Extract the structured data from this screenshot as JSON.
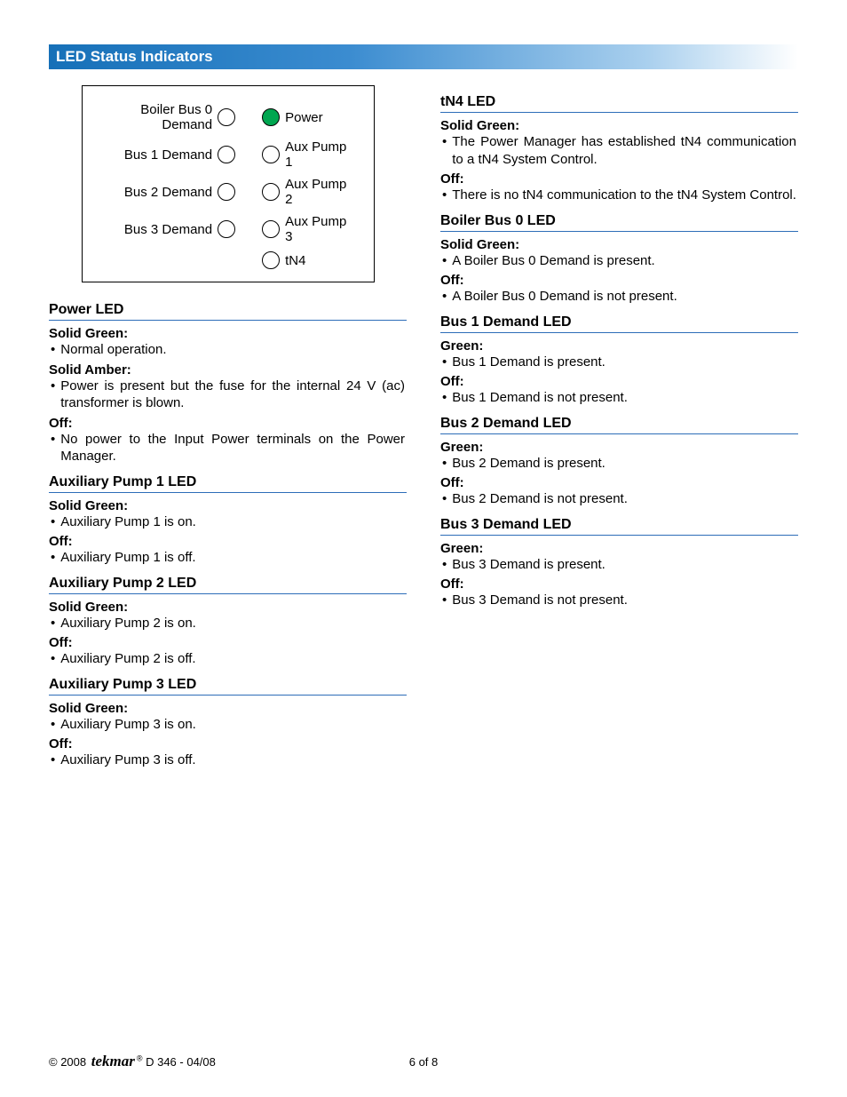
{
  "banner": "LED Status Indicators",
  "diagram": {
    "left": [
      "Boiler Bus 0 Demand",
      "Bus 1 Demand",
      "Bus 2 Demand",
      "Bus 3 Demand",
      ""
    ],
    "right": [
      "Power",
      "Aux Pump 1",
      "Aux Pump 2",
      "Aux Pump 3",
      "tN4"
    ],
    "greenIndex": 0
  },
  "leftSections": [
    {
      "title": "Power LED",
      "items": [
        {
          "state": "Solid Green:",
          "text": "Normal operation."
        },
        {
          "state": "Solid Amber:",
          "text": "Power is present but the fuse for the internal 24 V (ac) transformer is blown."
        },
        {
          "state": "Off:",
          "text": "No power to the Input Power terminals on the Power Manager."
        }
      ]
    },
    {
      "title": "Auxiliary Pump 1 LED",
      "items": [
        {
          "state": "Solid Green:",
          "text": "Auxiliary Pump 1 is on."
        },
        {
          "state": "Off:",
          "text": "Auxiliary Pump 1 is off."
        }
      ]
    },
    {
      "title": "Auxiliary Pump 2 LED",
      "items": [
        {
          "state": "Solid Green:",
          "text": "Auxiliary Pump 2 is on."
        },
        {
          "state": "Off:",
          "text": "Auxiliary Pump 2 is off."
        }
      ]
    },
    {
      "title": "Auxiliary Pump 3 LED",
      "items": [
        {
          "state": "Solid Green:",
          "text": "Auxiliary Pump 3 is on."
        },
        {
          "state": "Off:",
          "text": "Auxiliary Pump 3 is off."
        }
      ]
    }
  ],
  "rightSections": [
    {
      "title": "tN4 LED",
      "items": [
        {
          "state": "Solid Green:",
          "text": "The Power Manager has established tN4 communication to a tN4 System Control."
        },
        {
          "state": "Off:",
          "text": "There is no tN4 communication to the tN4 System Control."
        }
      ]
    },
    {
      "title": "Boiler Bus 0 LED",
      "items": [
        {
          "state": "Solid Green:",
          "text": "A Boiler Bus 0 Demand is present."
        },
        {
          "state": "Off:",
          "text": "A Boiler Bus 0 Demand is not present."
        }
      ]
    },
    {
      "title": "Bus 1 Demand LED",
      "items": [
        {
          "state": "Green:",
          "text": "Bus 1 Demand is present."
        },
        {
          "state": "Off:",
          "text": "Bus 1 Demand is not present."
        }
      ]
    },
    {
      "title": "Bus 2 Demand LED",
      "items": [
        {
          "state": "Green:",
          "text": "Bus 2 Demand is present."
        },
        {
          "state": "Off:",
          "text": "Bus 2 Demand is not present."
        }
      ]
    },
    {
      "title": "Bus 3 Demand LED",
      "items": [
        {
          "state": "Green:",
          "text": "Bus 3 Demand is present."
        },
        {
          "state": "Off:",
          "text": "Bus 3 Demand is not present."
        }
      ]
    }
  ],
  "footer": {
    "copyright": "© 2008 ",
    "brand": "tekmar",
    "doc": " D 346 - 04/08",
    "page": "6 of 8"
  }
}
